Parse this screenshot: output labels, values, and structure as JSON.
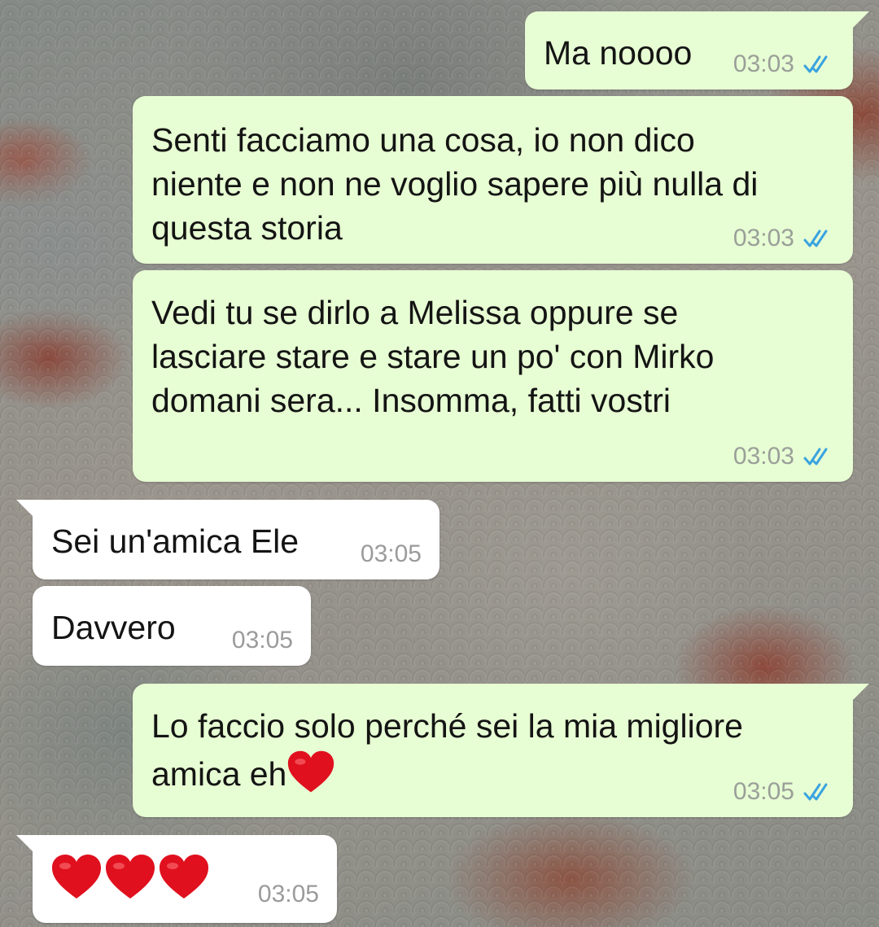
{
  "chat": {
    "messages": [
      {
        "direction": "outgoing",
        "text": "Ma noooo",
        "time": "03:03",
        "status": "read",
        "status_icon": "double-check-icon"
      },
      {
        "direction": "outgoing",
        "text": "Senti facciamo una cosa, io non dico\nniente e non ne voglio sapere più nulla di\nquesta storia",
        "time": "03:03",
        "status": "read",
        "status_icon": "double-check-icon"
      },
      {
        "direction": "outgoing",
        "text": "Vedi tu se dirlo a Melissa oppure se\nlasciare stare e stare un po' con Mirko\ndomani sera... Insomma, fatti vostri",
        "time": "03:03",
        "status": "read",
        "status_icon": "double-check-icon"
      },
      {
        "direction": "incoming",
        "text": "Sei un'amica Ele",
        "time": "03:05"
      },
      {
        "direction": "incoming",
        "text": "Davvero",
        "time": "03:05"
      },
      {
        "direction": "outgoing",
        "text_line1": "Lo faccio solo perché sei la mia migliore",
        "text_line2": "amica eh",
        "emoji": "red-heart-icon",
        "time": "03:05",
        "status": "read",
        "status_icon": "double-check-icon"
      },
      {
        "direction": "incoming",
        "emoji": [
          "red-heart-icon",
          "red-heart-icon",
          "red-heart-icon"
        ],
        "time": "03:05"
      }
    ]
  },
  "colors": {
    "outgoing_bubble": "#e7fdd3",
    "incoming_bubble": "#ffffff",
    "timestamp": "#9a9f99",
    "read_ticks": "#3aa3e0",
    "heart": "#e0101e"
  }
}
